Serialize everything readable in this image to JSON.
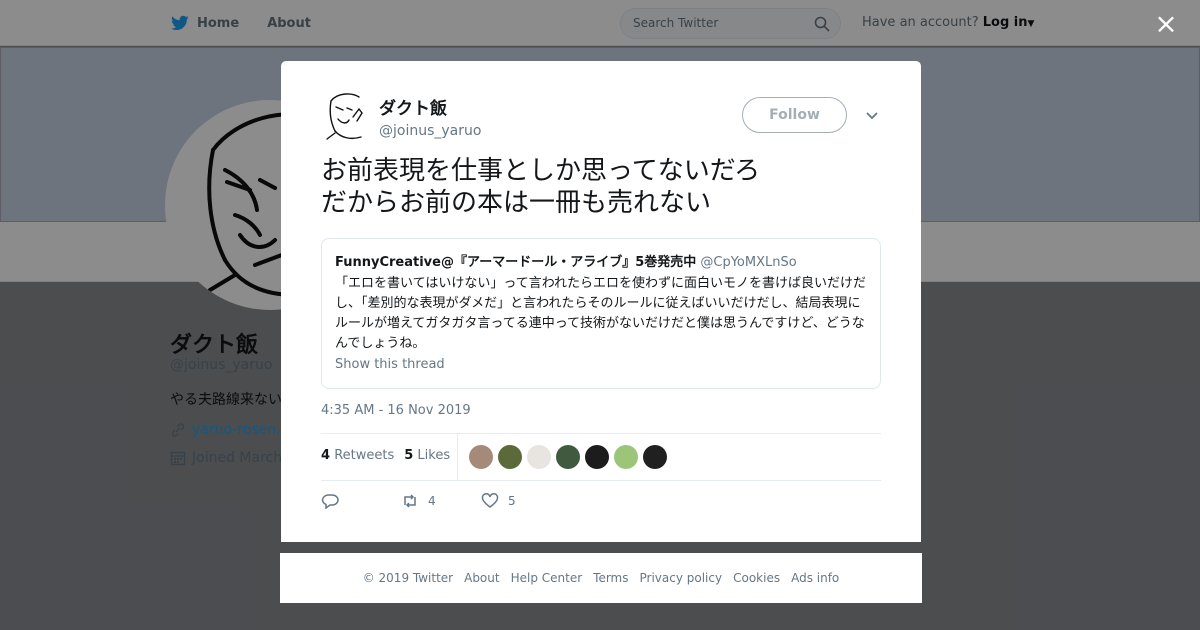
{
  "topbar": {
    "home_label": "Home",
    "about_label": "About",
    "search_placeholder": "Search Twitter",
    "account_prompt": "Have an account?",
    "login_label": "Log in"
  },
  "profile": {
    "name": "ダクト飯",
    "handle": "@joinus_yaruo",
    "bio": "やる夫路線来ない",
    "link": "yaruo-rosen.n",
    "joined": "Joined March"
  },
  "tweet": {
    "author_name": "ダクト飯",
    "author_handle": "@joinus_yaruo",
    "follow_label": "Follow",
    "text": "お前表現を仕事としか思ってないだろ\nだからお前の本は一冊も売れない",
    "quote": {
      "name": "FunnyCreative@『アーマードール・アライブ』5巻発売中",
      "handle": "@CpYoMXLnSo",
      "text": "「エロを書いてはいけない」って言われたらエロを使わずに面白いモノを書けば良いだけだし、「差別的な表現がダメだ」と言われたらそのルールに従えばいいだけだし、結局表現にルールが増えてガタガタ言ってる連中って技術がないだけだと僕は思うんですけど、どうなんでしょうね。",
      "thread_label": "Show this thread"
    },
    "timestamp": "4:35 AM - 16 Nov 2019",
    "retweets_count": "4",
    "retweets_label": "Retweets",
    "likes_count": "5",
    "likes_label": "Likes",
    "action_retweet_count": "4",
    "action_like_count": "5",
    "liker_colors": [
      "#a58a7a",
      "#5c6a3a",
      "#e8e4e0",
      "#3f5a3f",
      "#1c1c1c",
      "#9cc57a",
      "#202020"
    ]
  },
  "footer": {
    "links": [
      "© 2019 Twitter",
      "About",
      "Help Center",
      "Terms",
      "Privacy policy",
      "Cookies",
      "Ads info"
    ]
  },
  "close_label": "×"
}
